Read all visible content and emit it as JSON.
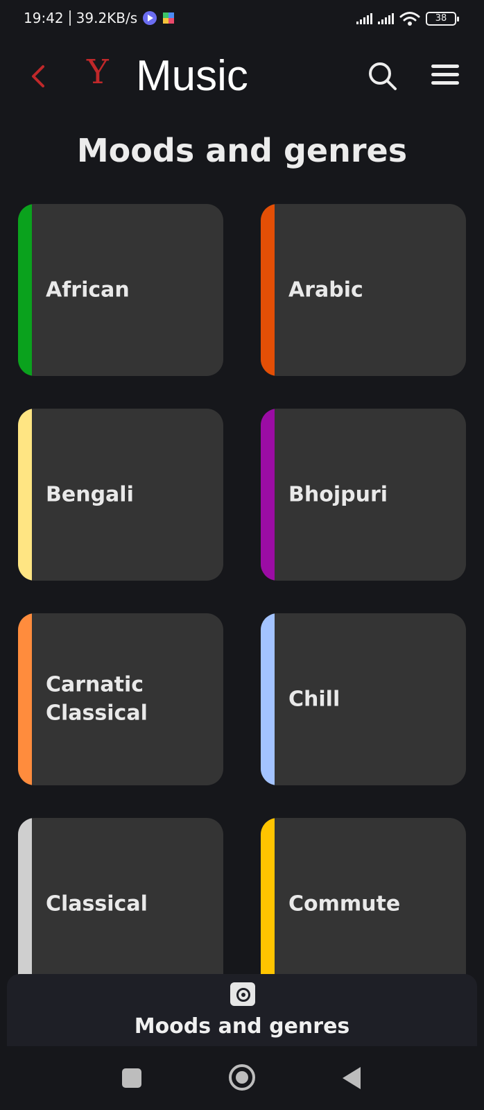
{
  "status": {
    "time": "19:42",
    "speed": "39.2KB/s",
    "battery": "38"
  },
  "header": {
    "logo": "Y",
    "title": "Music",
    "back_icon": "chevron-left-icon",
    "search_icon": "search-icon",
    "menu_icon": "hamburger-menu-icon",
    "logo_color": "#c0282a"
  },
  "page": {
    "title": "Moods and genres"
  },
  "genres": [
    {
      "label": "African",
      "accent": "#0aa21d"
    },
    {
      "label": "Arabic",
      "accent": "#e34f06"
    },
    {
      "label": "Bengali",
      "accent": "#ffe583"
    },
    {
      "label": "Bhojpuri",
      "accent": "#9b0ca4"
    },
    {
      "label": "Carnatic Classical",
      "accent": "#ff8c3d"
    },
    {
      "label": "Chill",
      "accent": "#a3c3ff"
    },
    {
      "label": "Classical",
      "accent": "#cfcfcf"
    },
    {
      "label": "Commute",
      "accent": "#ffc400"
    }
  ],
  "bottom_tab": {
    "icon": "disc-icon",
    "label": "Moods and genres"
  },
  "system_nav": {
    "recents_icon": "square-icon",
    "home_icon": "circle-icon",
    "back_icon": "triangle-back-icon"
  }
}
